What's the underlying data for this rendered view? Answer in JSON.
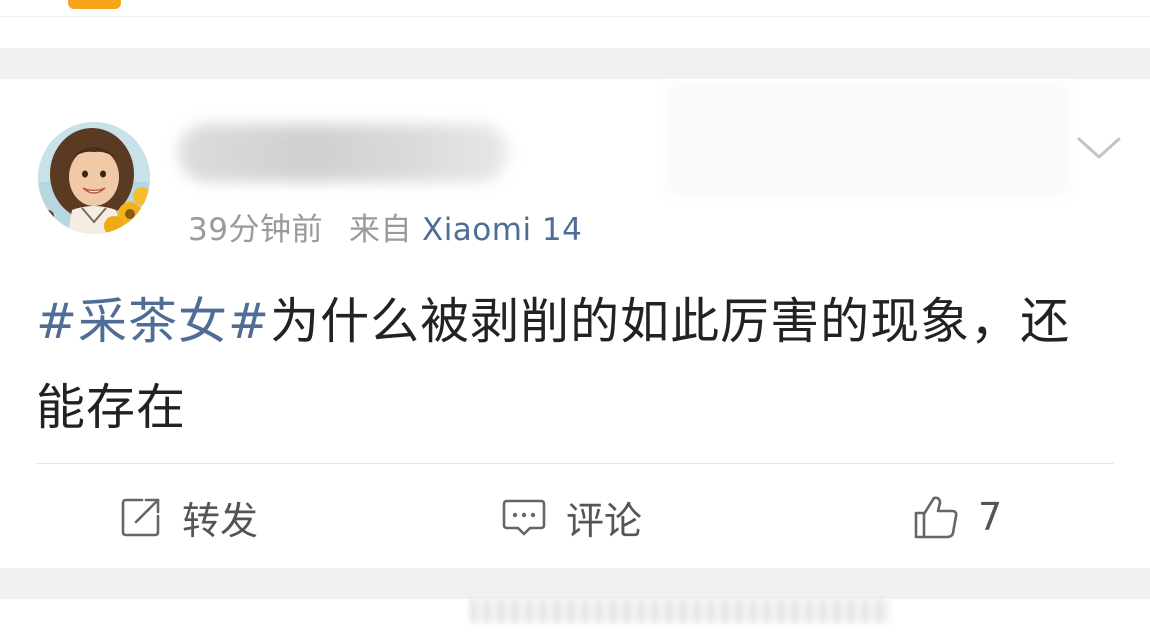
{
  "post": {
    "time": "39分钟前",
    "source_prefix": "来自",
    "source_device": "Xiaomi 14",
    "hashtag": "#采茶女#",
    "text": "为什么被剥削的如此厉害的现象，还能存在"
  },
  "actions": {
    "repost_label": "转发",
    "comment_label": "评论",
    "like_count": "7"
  },
  "colors": {
    "link": "#4f6d96",
    "text": "#222222",
    "meta": "#9a9a9a",
    "accent": "#f7a51c",
    "background_gap": "#f1f1f1"
  },
  "icons": [
    "repost-icon",
    "comment-icon",
    "like-icon",
    "chevron-down-icon",
    "avatar"
  ]
}
